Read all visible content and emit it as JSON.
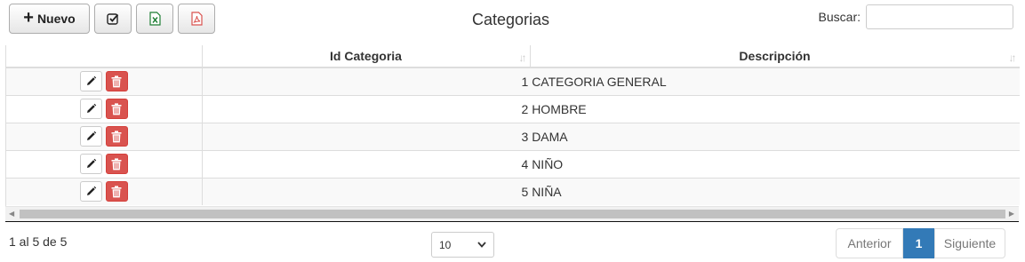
{
  "toolbar": {
    "new_label": "Nuevo",
    "new_icon": "plus-icon",
    "check_icon": "check-square-icon",
    "excel_icon": "excel-file-icon",
    "pdf_icon": "pdf-file-icon",
    "excel_color": "#1e7e34",
    "pdf_color": "#d9534f"
  },
  "title": "Categorias",
  "search": {
    "label": "Buscar:",
    "value": "",
    "placeholder": ""
  },
  "table": {
    "columns": [
      "",
      "Id Categoria",
      "Descripción"
    ],
    "rows": [
      {
        "id": "1",
        "desc": "CATEGORIA GENERAL"
      },
      {
        "id": "2",
        "desc": "HOMBRE"
      },
      {
        "id": "3",
        "desc": "DAMA"
      },
      {
        "id": "4",
        "desc": "NIÑO"
      },
      {
        "id": "5",
        "desc": "NIÑA"
      }
    ]
  },
  "footer": {
    "info": "1 al 5 de 5",
    "page_length": "10",
    "prev_label": "Anterior",
    "page": "1",
    "next_label": "Siguiente"
  }
}
